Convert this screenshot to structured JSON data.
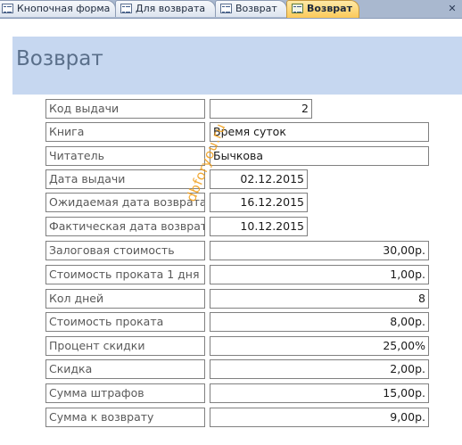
{
  "tabs": [
    {
      "label": "Кнопочная форма",
      "active": false
    },
    {
      "label": "Для возврата",
      "active": false
    },
    {
      "label": "Возврат",
      "active": false
    },
    {
      "label": "Возврат",
      "active": true
    }
  ],
  "close_glyph": "✕",
  "form": {
    "title": "Возврат",
    "fields": {
      "issue_code": {
        "label": "Код выдачи",
        "value": "2"
      },
      "book": {
        "label": "Книга",
        "value": "Время суток"
      },
      "reader": {
        "label": "Читатель",
        "value": "Бычкова"
      },
      "issue_date": {
        "label": "Дата выдачи",
        "value": "02.12.2015"
      },
      "expected_return_date": {
        "label": "Ожидаемая дата возврата",
        "value": "16.12.2015"
      },
      "actual_return_date": {
        "label": "Фактическая дата возврата",
        "value": "10.12.2015"
      },
      "deposit": {
        "label": "Залоговая стоимость",
        "value": "30,00р."
      },
      "daily_rate": {
        "label": "Стоимость проката 1 дня",
        "value": "1,00р."
      },
      "days": {
        "label": "Кол дней",
        "value": "8"
      },
      "rental_cost": {
        "label": "Стоимость проката",
        "value": "8,00р."
      },
      "discount_percent": {
        "label": "Процент скидки",
        "value": "25,00%"
      },
      "discount": {
        "label": "Скидка",
        "value": "2,00р."
      },
      "fines": {
        "label": "Сумма штрафов",
        "value": "15,00р."
      },
      "refund": {
        "label": "Сумма к возврату",
        "value": "9,00р."
      }
    }
  },
  "watermark": "dbforyou.ru",
  "colors": {
    "header_band": "#c6d7f0",
    "active_tab": "#fbc95a",
    "watermark": "#f0a020"
  }
}
